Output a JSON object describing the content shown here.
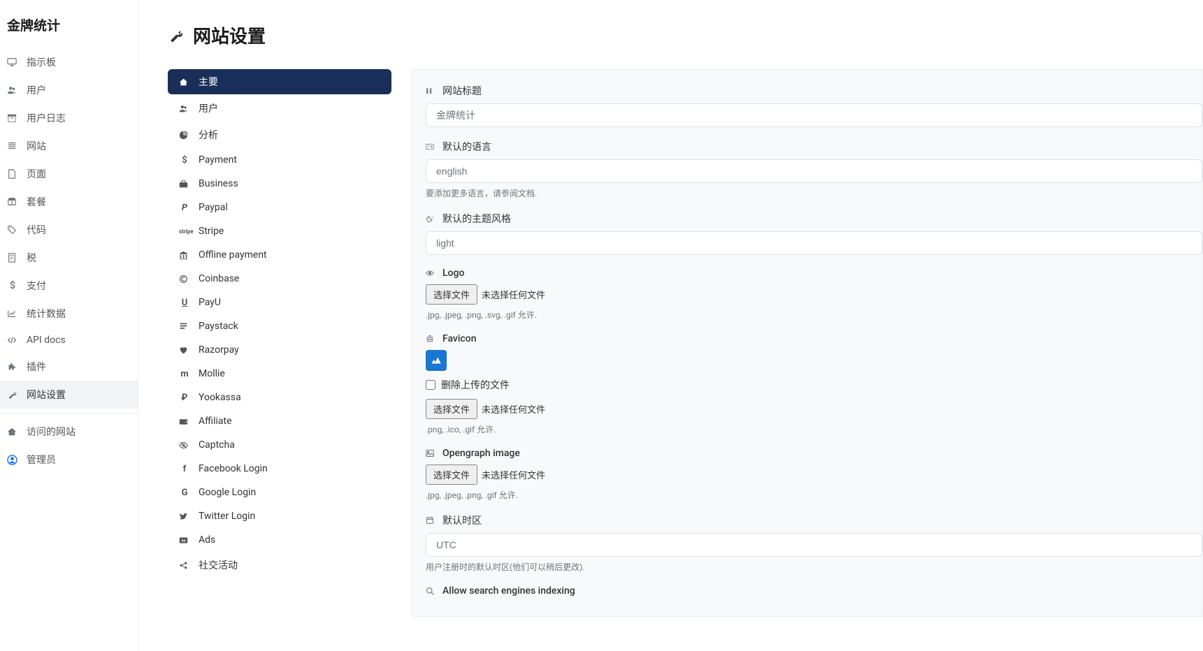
{
  "app_title": "金牌统计",
  "sidebar": {
    "items": [
      {
        "label": "指示板",
        "icon": "desktop"
      },
      {
        "label": "用户",
        "icon": "users"
      },
      {
        "label": "用户日志",
        "icon": "archive"
      },
      {
        "label": "网站",
        "icon": "bars"
      },
      {
        "label": "页面",
        "icon": "file"
      },
      {
        "label": "套餐",
        "icon": "box"
      },
      {
        "label": "代码",
        "icon": "tags"
      },
      {
        "label": "税",
        "icon": "receipt"
      },
      {
        "label": "支付",
        "icon": "dollar"
      },
      {
        "label": "统计数据",
        "icon": "chart"
      },
      {
        "label": "API docs",
        "icon": "code"
      },
      {
        "label": "插件",
        "icon": "puzzle"
      },
      {
        "label": "网站设置",
        "icon": "wrench",
        "active": true
      }
    ],
    "footer": [
      {
        "label": "访问的网站",
        "icon": "home"
      },
      {
        "label": "管理员",
        "icon": "user-circle",
        "admin": true
      }
    ]
  },
  "page": {
    "title": "网站设置"
  },
  "tabs": [
    {
      "label": "主要",
      "icon": "home",
      "active": true
    },
    {
      "label": "用户",
      "icon": "users"
    },
    {
      "label": "分析",
      "icon": "chart-pie"
    },
    {
      "label": "Payment",
      "icon": "dollar"
    },
    {
      "label": "Business",
      "icon": "briefcase"
    },
    {
      "label": "Paypal",
      "icon": "paypal"
    },
    {
      "label": "Stripe",
      "icon": "stripe"
    },
    {
      "label": "Offline payment",
      "icon": "bank"
    },
    {
      "label": "Coinbase",
      "icon": "coin"
    },
    {
      "label": "PayU",
      "icon": "payu"
    },
    {
      "label": "Paystack",
      "icon": "paystack"
    },
    {
      "label": "Razorpay",
      "icon": "heart"
    },
    {
      "label": "Mollie",
      "icon": "mollie"
    },
    {
      "label": "Yookassa",
      "icon": "ruble"
    },
    {
      "label": "Affiliate",
      "icon": "wallet"
    },
    {
      "label": "Captcha",
      "icon": "eye-icon"
    },
    {
      "label": "Facebook Login",
      "icon": "facebook"
    },
    {
      "label": "Google Login",
      "icon": "google"
    },
    {
      "label": "Twitter Login",
      "icon": "twitter"
    },
    {
      "label": "Ads",
      "icon": "ad"
    },
    {
      "label": "社交活动",
      "icon": "share"
    }
  ],
  "form": {
    "title": {
      "label": "网站标题",
      "value": "金牌统计"
    },
    "language": {
      "label": "默认的语言",
      "value": "english",
      "hint": "要添加更多语言，请参阅文档."
    },
    "theme": {
      "label": "默认的主题风格",
      "value": "light"
    },
    "logo": {
      "label": "Logo",
      "button": "选择文件",
      "no_file": "未选择任何文件",
      "hint": ".jpg, .jpeg, .png, .svg, .gif 允许."
    },
    "favicon": {
      "label": "Favicon",
      "delete": "删除上传的文件",
      "button": "选择文件",
      "no_file": "未选择任何文件",
      "hint": ".png, .ico, .gif 允许."
    },
    "opengraph": {
      "label": "Opengraph image",
      "button": "选择文件",
      "no_file": "未选择任何文件",
      "hint": ".jpg, .jpeg, .png, .gif 允许."
    },
    "timezone": {
      "label": "默认时区",
      "value": "UTC",
      "hint": "用户注册时的默认时区(他们可以稍后更改)."
    },
    "seo": {
      "label": "Allow search engines indexing"
    }
  }
}
